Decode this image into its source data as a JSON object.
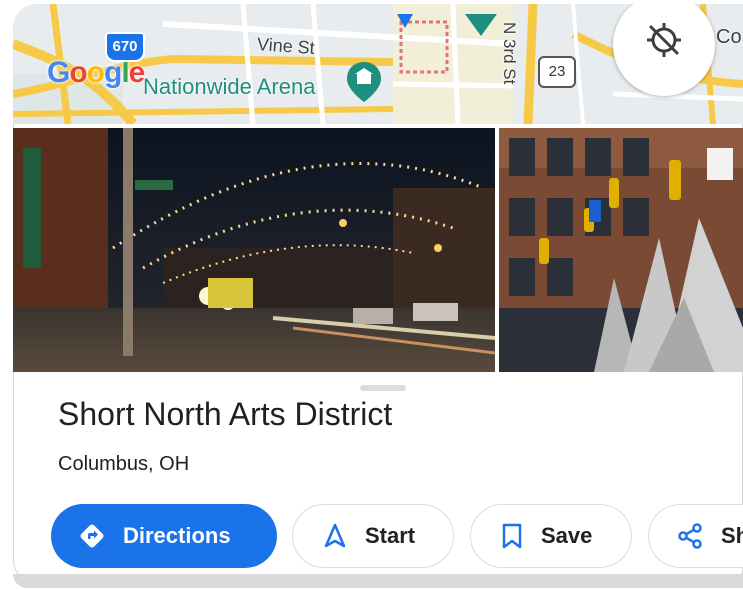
{
  "map": {
    "logo": [
      "G",
      "o",
      "o",
      "g",
      "l",
      "e"
    ],
    "street_vine": "Vine St",
    "poi_arena": "Nationwide Arena",
    "street_3rd": "N 3rd St",
    "label_partial": "Co",
    "shield_670": "670",
    "shield_23": "23",
    "compass_icon": "location-disabled-icon"
  },
  "place": {
    "name": "Short North Arts District",
    "location": "Columbus, OH"
  },
  "actions": {
    "directions": "Directions",
    "start": "Start",
    "save": "Save",
    "share": "Sh"
  },
  "colors": {
    "primary_blue": "#1a73e8",
    "text_dark": "#202124",
    "arena_teal": "#1e8e7e"
  }
}
